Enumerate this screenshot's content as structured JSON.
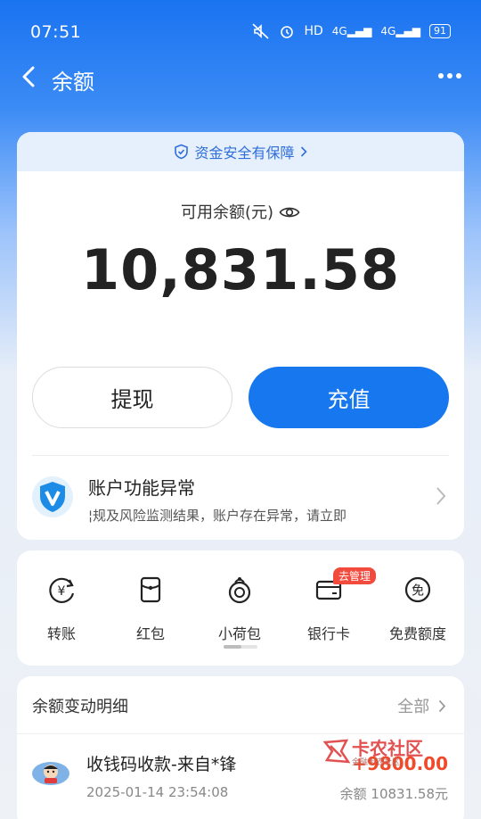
{
  "status_bar": {
    "time": "07:51",
    "hd": "HD",
    "net1": "4G",
    "net2": "4G",
    "battery": "91"
  },
  "nav": {
    "title": "余额"
  },
  "safety": {
    "text": "资金安全有保障"
  },
  "balance": {
    "label": "可用余额(元)",
    "value": "10,831.58"
  },
  "actions": {
    "withdraw": "提现",
    "recharge": "充值"
  },
  "alert": {
    "title": "账户功能异常",
    "description": "¦规及风险监测结果，账户存在异常，请立即"
  },
  "tools": [
    {
      "label": "转账",
      "icon": "transfer-icon"
    },
    {
      "label": "红包",
      "icon": "red-packet-icon"
    },
    {
      "label": "小荷包",
      "icon": "purse-icon"
    },
    {
      "label": "银行卡",
      "icon": "bank-card-icon",
      "badge": "去管理"
    },
    {
      "label": "免费额度",
      "icon": "free-quota-icon"
    }
  ],
  "details": {
    "title": "余额变动明细",
    "all_label": "全部",
    "transactions": [
      {
        "title": "收钱码收款-来自*锋",
        "time": "2025-01-14 23:54:08",
        "amount": "+9800.00",
        "balance": "余额 10831.58元"
      }
    ]
  },
  "watermark": {
    "text": "卡农社区",
    "sub": "金融卡农社区"
  },
  "colors": {
    "primary": "#1677ee",
    "alert_red": "#f04a2a",
    "badge": "#f24a3d"
  }
}
